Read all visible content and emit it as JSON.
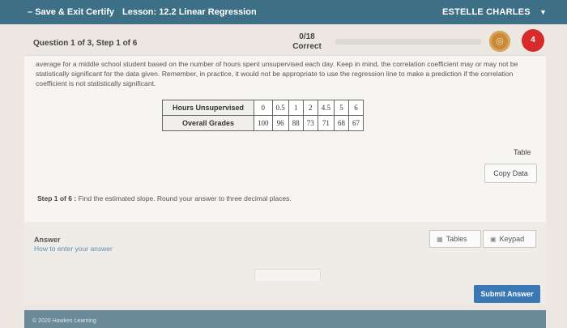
{
  "topbar": {
    "back_label": "Save & Exit Certify",
    "lesson": "Lesson: 12.2 Linear Regression",
    "user": "ESTELLE CHARLES",
    "caret": "▼"
  },
  "question": {
    "label": "Question 1 of 3, Step 1 of 6",
    "score": "0/18",
    "score_status": "Correct",
    "progress_fraction": 0,
    "coin_symbol": "◎",
    "lives": "4",
    "description": "average for a middle school student based on the number of hours spent unsupervised each day. Keep in mind, the correlation coefficient may or may not be statistically significant for the data given. Remember, in practice, it would not be appropriate to use the regression line to make a prediction if the correlation coefficient is not statistically significant."
  },
  "table": {
    "rows": [
      {
        "header": "Hours Unsupervised",
        "cells": [
          "0",
          "0.5",
          "1",
          "2",
          "4.5",
          "5",
          "6"
        ]
      },
      {
        "header": "Overall Grades",
        "cells": [
          "100",
          "96",
          "88",
          "73",
          "71",
          "68",
          "67"
        ]
      }
    ],
    "table_link": "Table",
    "copy_label": "Copy Data"
  },
  "step": {
    "prefix": "Step 1 of 6 :",
    "text": "Find the estimated slope. Round your answer to three decimal places."
  },
  "answer": {
    "label": "Answer",
    "help_link": "How to enter your answer",
    "tables_label": "Tables",
    "keypad_label": "Keypad",
    "submit_label": "Submit Answer"
  },
  "footer": {
    "copyright": "© 2020 Hawkes Learning"
  },
  "colors": {
    "topbar": "#3d6f86",
    "submit": "#3a78b5",
    "heart": "#d82a2a",
    "coin": "#c8893a"
  }
}
